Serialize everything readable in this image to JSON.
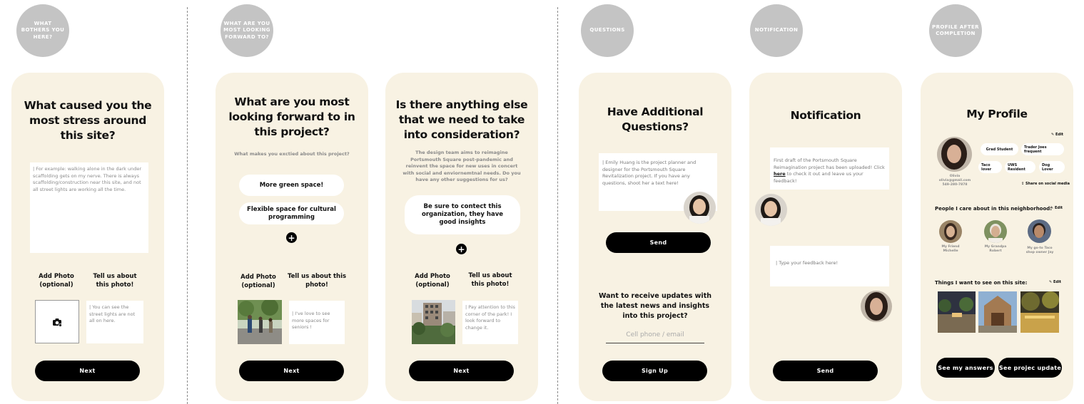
{
  "steps": [
    {
      "label": "WHAT BOTHERS YOU HERE?"
    },
    {
      "label": "WHAT ARE YOU MOST LOOKING FORWARD TO?"
    },
    {
      "label": "QUESTIONS"
    },
    {
      "label": "NOTIFICATION"
    },
    {
      "label": "PROFILE AFTER COMPLETION"
    }
  ],
  "card1": {
    "title": "What caused you the most stress around this site?",
    "textbox": "| For example: walking alone in the dark under scaffolding gets on my nerve. There is always scaffolding/construction near this site, and not all street lights are working all the time.",
    "add_photo": "Add Photo (optional)",
    "tell_us": "Tell us about this photo!",
    "photo_note": "| You can see the street lights are not all on here.",
    "next": "Next"
  },
  "card2": {
    "title": "What are you most looking forward to in this project?",
    "subtitle": "What makes you exctied about this project?",
    "options": [
      "More green space!",
      "Flexible space for cultural programming"
    ],
    "add_photo": "Add Photo (optional)",
    "tell_us": "Tell us about this photo!",
    "photo_note": "| I've love to see more spaces for seniors !",
    "next": "Next"
  },
  "card3": {
    "title": "Is there anything else that we need to take into consideration?",
    "subtitle": "The design team aims to reimagine Portsmouth Square post-pandemic and reinvent the space for new uses in concert with social and enviornemtnal needs. Do you have any other suggestions for us?",
    "answer": "Be sure to contect this organization, they have good insights",
    "add_photo": "Add Photo (optional)",
    "tell_us": "Tell us about this photo!",
    "photo_note": "| Pay attention to this corner of the park! I look forward to change it.",
    "next": "Next"
  },
  "card4": {
    "title": "Have Additional Questions?",
    "message": "| Emily Huang is the project planner and designer for the Portsmouth Square Revitalization project. If you have any questions, shoot her a text here!",
    "send": "Send",
    "updates_q": "Want to receive updates with the latest news and insights into this project?",
    "phone_placeholder": "Cell phone / email",
    "signup": "Sign Up"
  },
  "card5": {
    "title": "Notification",
    "notice_pre": "First draft of the Portsmouth Square Reimagination project has been uploaded! Click ",
    "notice_link": "here",
    "notice_post": " to check it out and leave us your feedback!",
    "feedback_placeholder": "| Type your feedback here!",
    "send": "Send"
  },
  "card6": {
    "title": "My Profile",
    "edit": "Edit",
    "name": "Olivia",
    "email": "olivia@gmail.com",
    "phone": "549-280-7878",
    "tags": [
      "Grad Student",
      "Trader Joes frequent",
      "Taco lover",
      "UWS Resident",
      "Dog Lover"
    ],
    "share": "Share on social media",
    "people_heading": "People I care about in this neighborhood:",
    "people": [
      {
        "label": "My Friend Michelle"
      },
      {
        "label": "My Grandpa Robert"
      },
      {
        "label": "My go-to Taco shop owner Jay"
      }
    ],
    "things_heading": "Things I want to see on this site:",
    "see_answers": "See my answers",
    "see_update": "See projec update"
  },
  "colors": {
    "card_bg": "#f8f2e3",
    "circle_gray": "#c4c4c4",
    "button_black": "#000000"
  }
}
